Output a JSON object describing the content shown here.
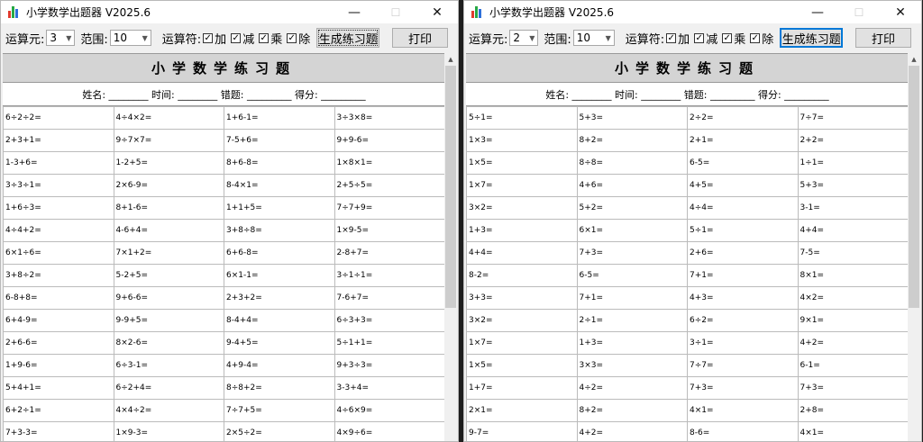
{
  "title": "小学数学出题器 V2025.6",
  "colors": {
    "accent": "#0078d7",
    "header_bg": "#d4d4d4"
  },
  "icons": {
    "app": "bar-chart-app-icon",
    "minimize": "minimize-icon",
    "maximize": "maximize-icon",
    "close": "close-icon",
    "scroll_up": "chevron-up-icon"
  },
  "labels": {
    "operands": "运算元:",
    "range": "范围:",
    "operators": "运算符:",
    "add": "加",
    "sub": "减",
    "mul": "乘",
    "div": "除",
    "generate": "生成练习题",
    "print": "打印",
    "sheet_title": "小学数学练习题",
    "info": "姓名: ________ 时间: ________ 错题: _________ 得分: _________"
  },
  "windows": [
    {
      "operands": "3",
      "range": "10",
      "checks": {
        "add": true,
        "sub": true,
        "mul": true,
        "div": true
      },
      "rows": [
        [
          "6÷2÷2=",
          "4÷4×2=",
          "1+6-1=",
          "3÷3×8="
        ],
        [
          "2+3+1=",
          "9÷7×7=",
          "7-5+6=",
          "9+9-6="
        ],
        [
          "1-3+6=",
          "1-2+5=",
          "8+6-8=",
          "1×8×1="
        ],
        [
          "3÷3÷1=",
          "2×6-9=",
          "8-4×1=",
          "2+5÷5="
        ],
        [
          "1+6÷3=",
          "8+1-6=",
          "1+1+5=",
          "7÷7+9="
        ],
        [
          "4÷4+2=",
          "4-6+4=",
          "3+8÷8=",
          "1×9-5="
        ],
        [
          "6×1÷6=",
          "7×1+2=",
          "6+6-8=",
          "2-8+7="
        ],
        [
          "3+8÷2=",
          "5-2+5=",
          "6×1-1=",
          "3÷1÷1="
        ],
        [
          "6-8+8=",
          "9+6-6=",
          "2+3+2=",
          "7-6+7="
        ],
        [
          "6+4-9=",
          "9-9+5=",
          "8-4+4=",
          "6÷3+3="
        ],
        [
          "2+6-6=",
          "8×2-6=",
          "9-4+5=",
          "5÷1+1="
        ],
        [
          "1+9-6=",
          "6÷3-1=",
          "4+9-4=",
          "9+3÷3="
        ],
        [
          "5+4+1=",
          "6÷2+4=",
          "8÷8+2=",
          "3-3+4="
        ],
        [
          "6+2÷1=",
          "4×4÷2=",
          "7÷7+5=",
          "4÷6×9="
        ],
        [
          "7+3-3=",
          "1×9-3=",
          "2×5÷2=",
          "4×9÷6="
        ]
      ]
    },
    {
      "operands": "2",
      "range": "10",
      "checks": {
        "add": true,
        "sub": true,
        "mul": true,
        "div": true
      },
      "rows": [
        [
          "5÷1=",
          "5+3=",
          "2÷2=",
          "7÷7="
        ],
        [
          "1×3=",
          "8+2=",
          "2+1=",
          "2+2="
        ],
        [
          "1×5=",
          "8÷8=",
          "6-5=",
          "1÷1="
        ],
        [
          "1×7=",
          "4+6=",
          "4+5=",
          "5+3="
        ],
        [
          "3×2=",
          "5+2=",
          "4÷4=",
          "3-1="
        ],
        [
          "1+3=",
          "6×1=",
          "5÷1=",
          "4+4="
        ],
        [
          "4+4=",
          "7+3=",
          "2+6=",
          "7-5="
        ],
        [
          "8-2=",
          "6-5=",
          "7+1=",
          "8×1="
        ],
        [
          "3+3=",
          "7+1=",
          "4+3=",
          "4×2="
        ],
        [
          "3×2=",
          "2÷1=",
          "6÷2=",
          "9×1="
        ],
        [
          "1×7=",
          "1+3=",
          "3÷1=",
          "4+2="
        ],
        [
          "1×5=",
          "3×3=",
          "7÷7=",
          "6-1="
        ],
        [
          "1+7=",
          "4÷2=",
          "7+3=",
          "7+3="
        ],
        [
          "2×1=",
          "8+2=",
          "4×1=",
          "2+8="
        ],
        [
          "9-7=",
          "4+2=",
          "8-6=",
          "4×1="
        ]
      ]
    }
  ]
}
